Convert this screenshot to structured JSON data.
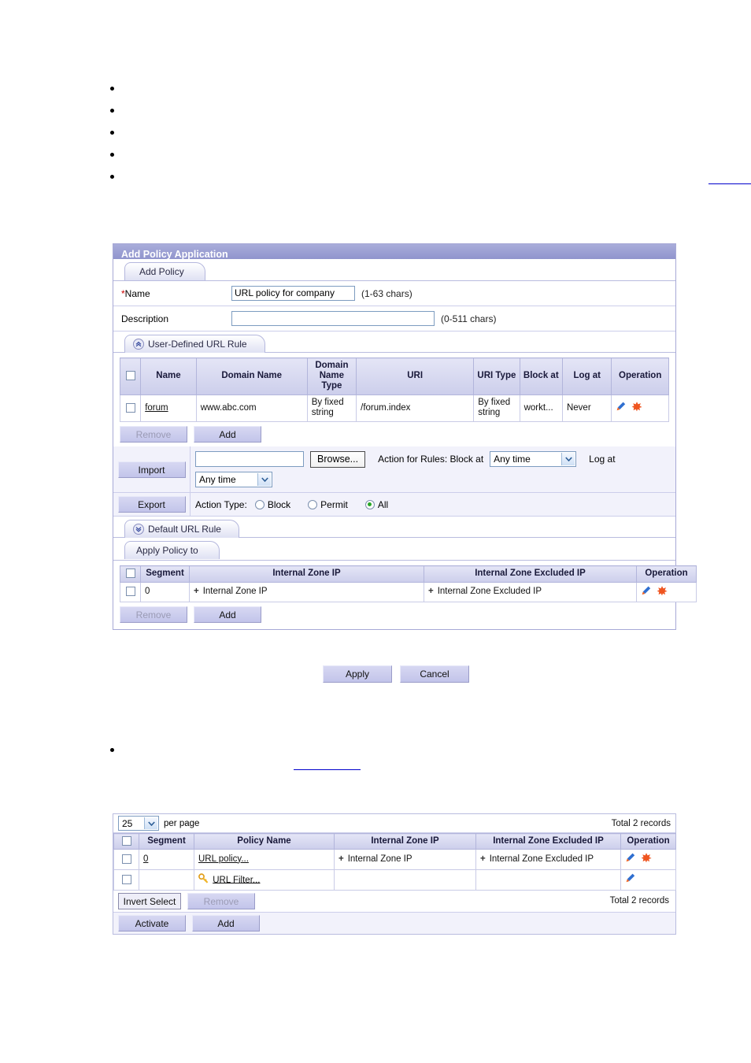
{
  "panel": {
    "title": "Add Policy Application",
    "tab_add_policy": "Add Policy",
    "name_label": "Name",
    "name_required_mark": "*",
    "name_value": "URL policy for company",
    "name_hint": "(1-63  chars)",
    "description_label": "Description",
    "description_value": "",
    "description_hint": "(0-511  chars)",
    "section_user_defined": "User-Defined URL Rule",
    "section_default": "Default URL Rule",
    "section_apply_policy_to": "Apply Policy to"
  },
  "url_rule_table": {
    "headers": [
      "",
      "Name",
      "Domain Name",
      "Domain Name Type",
      "URI",
      "URI Type",
      "Block at",
      "Log at",
      "Operation"
    ],
    "rows": [
      {
        "name": "forum",
        "domain_name": "www.abc.com",
        "domain_name_type": "By fixed string",
        "uri": "/forum.index",
        "uri_type": "By fixed string",
        "block_at": "workt...",
        "log_at": "Never"
      }
    ],
    "remove_label": "Remove",
    "add_label": "Add"
  },
  "import_export": {
    "import_label": "Import",
    "export_label": "Export",
    "file_value": "",
    "browse_label": "Browse...",
    "action_for_rules_label": "Action for Rules: Block at",
    "block_at_value": "Any time",
    "log_at_label": "Log at",
    "log_at_value": "Any time",
    "action_type_label": "Action Type:",
    "radio_block": "Block",
    "radio_permit": "Permit",
    "radio_all": "All",
    "selected_action_type": "All"
  },
  "apply_policy_table": {
    "headers": [
      "",
      "Segment",
      "Internal Zone IP",
      "Internal Zone Excluded IP",
      "Operation"
    ],
    "rows": [
      {
        "segment": "0",
        "internal_zone_ip": "Internal Zone IP",
        "internal_zone_excluded_ip": "Internal Zone Excluded IP"
      }
    ],
    "remove_label": "Remove",
    "add_label": "Add"
  },
  "footer": {
    "apply_label": "Apply",
    "cancel_label": "Cancel"
  },
  "policy_list": {
    "per_page_value": "25",
    "per_page_label": "per page",
    "total_top": "Total 2 records",
    "total_bottom": "Total 2 records",
    "headers": [
      "",
      "Segment",
      "Policy Name",
      "Internal Zone IP",
      "Internal Zone Excluded IP",
      "Operation"
    ],
    "rows": [
      {
        "segment": "0",
        "policy_name": "URL policy...",
        "internal_zone_ip": "Internal Zone IP",
        "internal_zone_excluded_ip": "Internal Zone Excluded IP",
        "has_key_icon": false,
        "has_delete": true
      },
      {
        "segment": "",
        "policy_name": "URL Filter...",
        "internal_zone_ip": "",
        "internal_zone_excluded_ip": "",
        "has_key_icon": true,
        "has_delete": false
      }
    ],
    "invert_select_label": "Invert Select",
    "remove_label": "Remove",
    "activate_label": "Activate",
    "add_label": "Add"
  },
  "colors": {
    "titlebar": "#9094cd",
    "table_header": "#ccceeb",
    "button_face": "#c2c4ea",
    "link_blue": "#0000cc",
    "radio_selected": "#27a527",
    "delete_icon": "#f0611f",
    "edit_icon": "#2f6fd0",
    "key_icon": "#f0b428"
  },
  "plus_glyph": "+"
}
